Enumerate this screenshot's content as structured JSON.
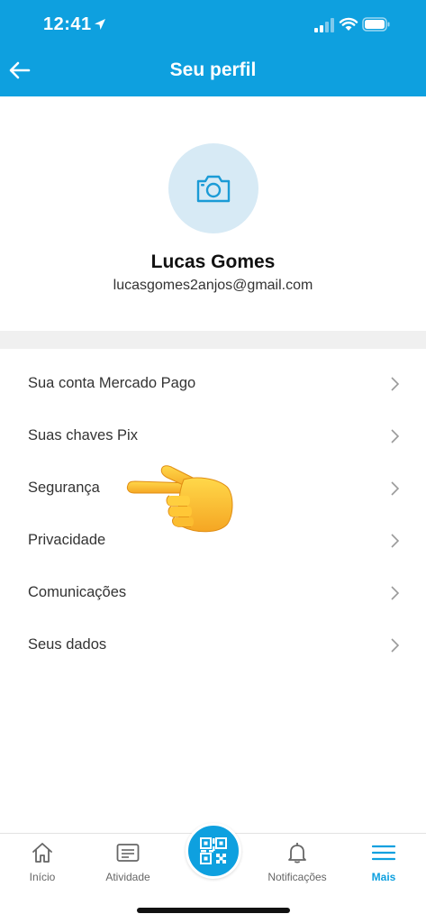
{
  "status_bar": {
    "time": "12:41",
    "icons": [
      "location-arrow-icon",
      "cellular-signal-icon",
      "wifi-icon",
      "battery-icon"
    ]
  },
  "header": {
    "title": "Seu perfil",
    "back_icon": "arrow-left-icon",
    "color": "#0ea0df"
  },
  "profile": {
    "avatar_icon": "camera-icon",
    "name": "Lucas Gomes",
    "email": "lucasgomes2anjos@gmail.com"
  },
  "menu": {
    "items": [
      {
        "label": "Sua conta Mercado Pago"
      },
      {
        "label": "Suas chaves Pix"
      },
      {
        "label": "Segurança"
      },
      {
        "label": "Privacidade"
      },
      {
        "label": "Comunicações"
      },
      {
        "label": "Seus dados"
      }
    ],
    "chevron_icon": "chevron-right-icon",
    "highlight_icon": "pointing-hand-icon"
  },
  "tab_bar": {
    "tabs": [
      {
        "label": "Início",
        "icon": "home-icon"
      },
      {
        "label": "Atividade",
        "icon": "activity-icon"
      },
      {
        "label": "Notificações",
        "icon": "bell-icon"
      },
      {
        "label": "Mais",
        "icon": "menu-icon",
        "active": true
      }
    ],
    "center_icon": "qr-code-icon",
    "accent_color": "#0ea0df"
  }
}
